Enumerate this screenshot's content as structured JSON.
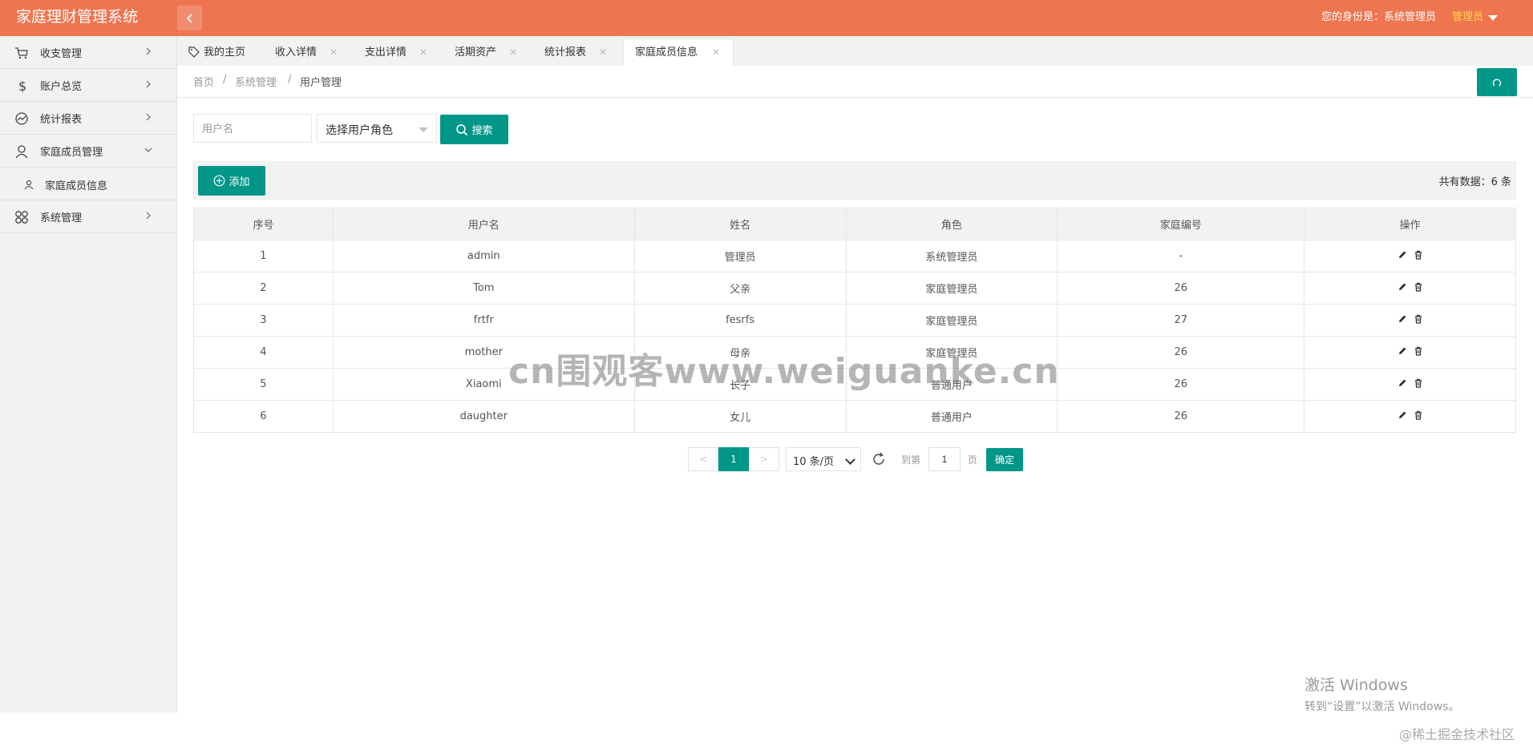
{
  "header": {
    "title": "家庭理财管理系统",
    "identity": "您的身份是：系统管理员",
    "user_menu": "管理员"
  },
  "sidebar": {
    "items": [
      {
        "label": "收支管理",
        "icon": "cart-icon"
      },
      {
        "label": "账户总览",
        "icon": "dollar-icon"
      },
      {
        "label": "统计报表",
        "icon": "chart-icon"
      },
      {
        "label": "家庭成员管理",
        "icon": "user-icon",
        "expanded": true
      },
      {
        "label": "系统管理",
        "icon": "grid-icon"
      }
    ],
    "sub_items": [
      {
        "label": "家庭成员信息",
        "icon": "user-icon"
      }
    ]
  },
  "tabs": [
    {
      "label": "我的主页",
      "icon": "tag-icon"
    },
    {
      "label": "收入详情"
    },
    {
      "label": "支出详情"
    },
    {
      "label": "活期资产"
    },
    {
      "label": "统计报表"
    },
    {
      "label": "家庭成员信息",
      "active": true
    }
  ],
  "breadcrumb": [
    "首页",
    "系统管理",
    "用户管理"
  ],
  "search": {
    "username_placeholder": "用户名",
    "role_select": "选择用户角色",
    "button": "搜索"
  },
  "toolbar": {
    "add_button": "添加",
    "total": "共有数据：6 条"
  },
  "table": {
    "columns": [
      "序号",
      "用户名",
      "姓名",
      "角色",
      "家庭编号",
      "操作"
    ],
    "rows": [
      [
        "1",
        "admin",
        "管理员",
        "系统管理员",
        "-"
      ],
      [
        "2",
        "Tom",
        "父亲",
        "家庭管理员",
        "26"
      ],
      [
        "3",
        "frtfr",
        "fesrfs",
        "家庭管理员",
        "27"
      ],
      [
        "4",
        "mother",
        "母亲",
        "家庭管理员",
        "26"
      ],
      [
        "5",
        "Xiaomi",
        "长子",
        "普通用户",
        "26"
      ],
      [
        "6",
        "daughter",
        "女儿",
        "普通用户",
        "26"
      ]
    ]
  },
  "pagination": {
    "prev": "<",
    "current": "1",
    "next": ">",
    "page_size": "10 条/页",
    "goto_label": "到第",
    "page_value": "1",
    "page_unit": "页",
    "confirm": "确定"
  },
  "overlay": {
    "watermark": "cn围观客www.weiguanke.cn",
    "win_line1": "激活 Windows",
    "win_line2": "转到“设置”以激活 Windows。",
    "credit": "@稀土掘金技术社区"
  },
  "colors": {
    "header": "#ee7550",
    "accent": "#009688",
    "sidebar": "#f2f2f2"
  }
}
